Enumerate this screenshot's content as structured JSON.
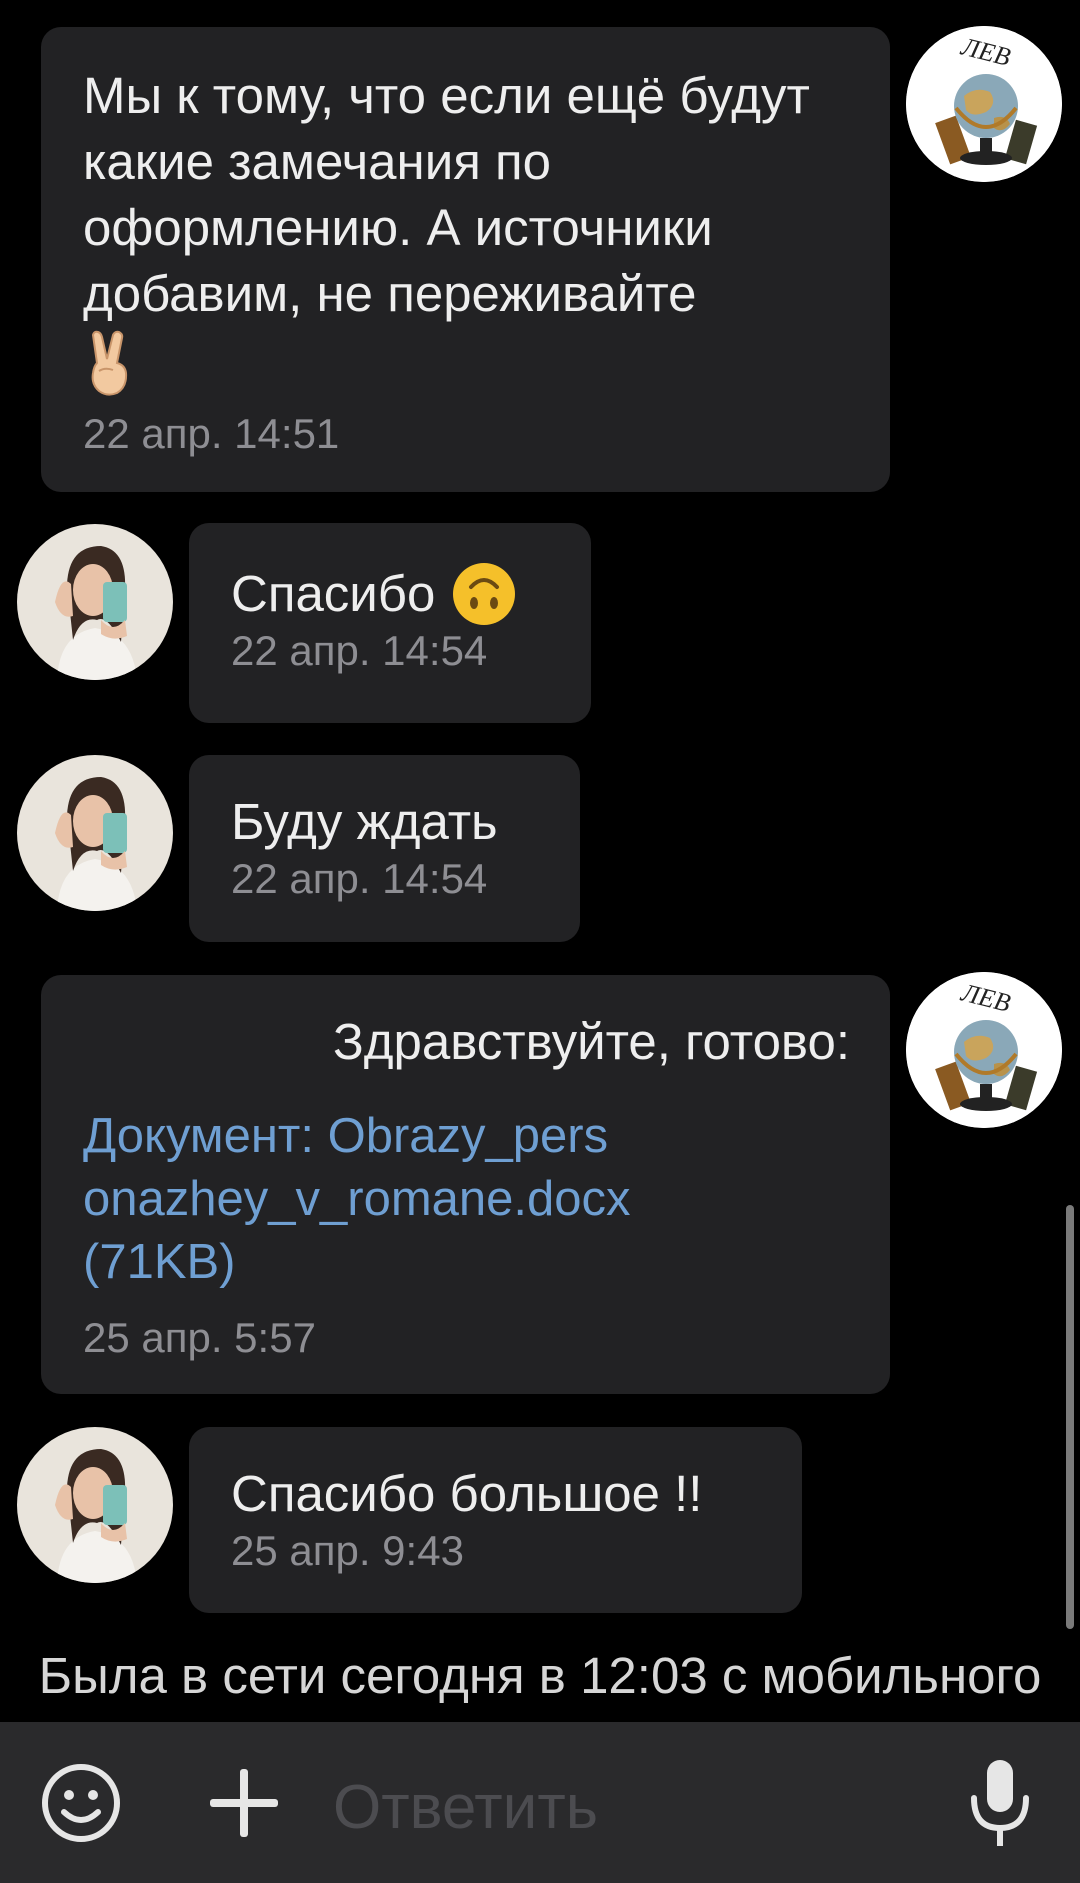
{
  "messages": [
    {
      "side": "outgoing",
      "text": "Мы к тому, что если ещё будут какие замечания по оформлению. А источники добавим, не переживайте",
      "emoji": "victory-hand-emoji",
      "time": "22 апр. 14:51"
    },
    {
      "side": "incoming",
      "text": "Спасибо",
      "emoji": "upside-down-face-emoji",
      "time": "22 апр. 14:54"
    },
    {
      "side": "incoming",
      "text": "Буду ждать",
      "time": "22 апр. 14:54"
    },
    {
      "side": "outgoing",
      "text": "Здравствуйте, готово:",
      "attachment": "Документ: Obrazy_pers onazhey_v_romane.docx (71KB)",
      "time": "25 апр. 5:57"
    },
    {
      "side": "incoming",
      "text": "Спасибо большое !!",
      "time": "25 апр. 9:43"
    }
  ],
  "outgoing_avatar_text": "ЛЕВ",
  "status": "Была в сети сегодня в 12:03 с мобильного",
  "composer": {
    "placeholder": "Ответить",
    "icons": [
      "emoji-smile-icon",
      "plus-icon",
      "microphone-icon"
    ]
  },
  "colors": {
    "background": "#000000",
    "bubble": "#222224",
    "link": "#6f9fd2",
    "timestamp": "#8e8e93"
  }
}
